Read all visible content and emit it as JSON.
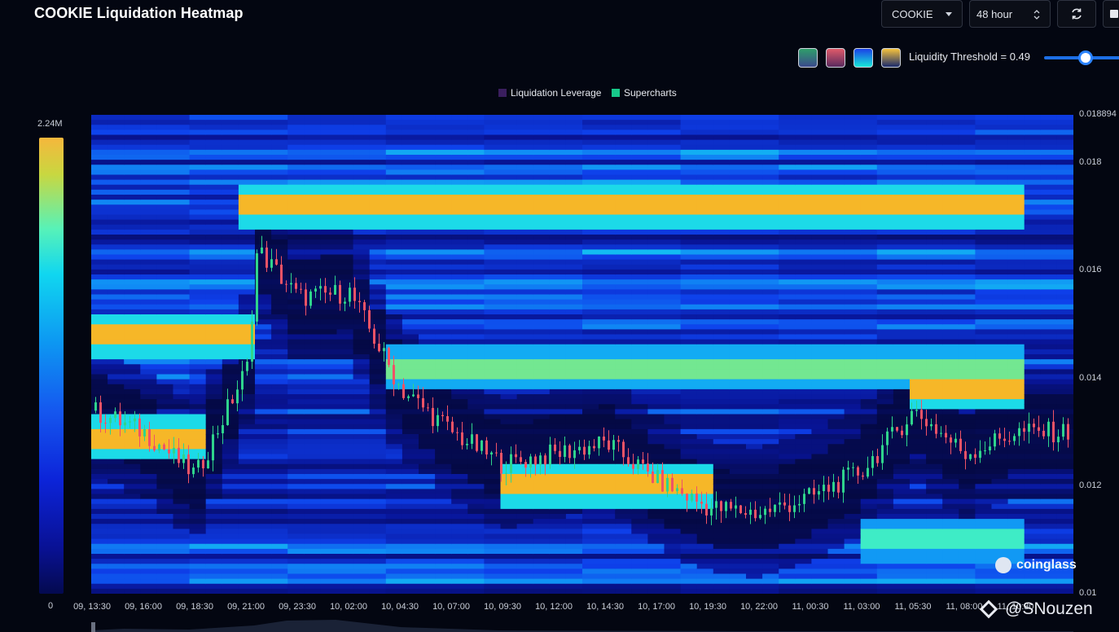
{
  "header": {
    "title": "COOKIE Liquidation Heatmap",
    "symbol_value": "COOKIE",
    "range_value": "48 hour"
  },
  "controls": {
    "threshold_label": "Liquidity Threshold = 0.49",
    "threshold_value": 0.49,
    "palettes": [
      {
        "name": "palette-1",
        "from": "#2e9e6a",
        "to": "#3c4a8c"
      },
      {
        "name": "palette-2",
        "from": "#e05a6a",
        "to": "#5a2a5e"
      },
      {
        "name": "palette-3",
        "from": "#1a40e8",
        "to": "#18e8d8"
      },
      {
        "name": "palette-4",
        "from": "#f6c23c",
        "to": "#1a2a6c"
      }
    ]
  },
  "legend": [
    {
      "label": "Liquidation Leverage",
      "color": "#3a1e5e"
    },
    {
      "label": "Supercharts",
      "color": "#17c98a"
    }
  ],
  "colorbar": {
    "max_label": "2.24M",
    "min_label": "0"
  },
  "brand": "coinglass",
  "credit": "@SNouzen",
  "chart_data": {
    "type": "heatmap",
    "title": "COOKIE Liquidation Heatmap",
    "x_ticks": [
      "09, 13:30",
      "09, 16:00",
      "09, 18:30",
      "09, 21:00",
      "09, 23:30",
      "10, 02:00",
      "10, 04:30",
      "10, 07:00",
      "10, 09:30",
      "10, 12:00",
      "10, 14:30",
      "10, 17:00",
      "10, 19:30",
      "10, 22:00",
      "11, 00:30",
      "11, 03:00",
      "11, 05:30",
      "11, 08:00",
      "11, 10:30"
    ],
    "y_ticks": [
      "0.018894",
      "0.018",
      "0.016",
      "0.014",
      "0.012",
      "0.01"
    ],
    "ylim": [
      0.01,
      0.018894
    ],
    "value_range": [
      0,
      2240000
    ],
    "price_close_path": [
      {
        "t": "09, 13:30",
        "price": 0.0134
      },
      {
        "t": "09, 16:00",
        "price": 0.013
      },
      {
        "t": "09, 18:30",
        "price": 0.0122
      },
      {
        "t": "09, 21:00",
        "price": 0.0142
      },
      {
        "t": "09, 21:30",
        "price": 0.0164
      },
      {
        "t": "09, 23:30",
        "price": 0.0155
      },
      {
        "t": "10, 02:00",
        "price": 0.0156
      },
      {
        "t": "10, 04:30",
        "price": 0.0138
      },
      {
        "t": "10, 07:00",
        "price": 0.013
      },
      {
        "t": "10, 09:30",
        "price": 0.0124
      },
      {
        "t": "10, 12:00",
        "price": 0.0126
      },
      {
        "t": "10, 14:30",
        "price": 0.0128
      },
      {
        "t": "10, 17:00",
        "price": 0.0121
      },
      {
        "t": "10, 19:30",
        "price": 0.0116
      },
      {
        "t": "10, 22:00",
        "price": 0.0115
      },
      {
        "t": "11, 00:30",
        "price": 0.0118
      },
      {
        "t": "11, 03:00",
        "price": 0.0123
      },
      {
        "t": "11, 05:30",
        "price": 0.0134
      },
      {
        "t": "11, 08:00",
        "price": 0.0126
      },
      {
        "t": "11, 10:30",
        "price": 0.013
      }
    ],
    "liquidation_bands": [
      {
        "price": 0.0172,
        "level": 1.0,
        "from": "09, 21:00",
        "to": "11, 10:30"
      },
      {
        "price": 0.0148,
        "level": 1.0,
        "from": "09, 13:30",
        "to": "09, 21:00"
      },
      {
        "price": 0.0142,
        "level": 0.85,
        "from": "10, 04:30",
        "to": "11, 10:30"
      },
      {
        "price": 0.0138,
        "level": 1.0,
        "from": "11, 05:30",
        "to": "11, 10:30"
      },
      {
        "price": 0.0129,
        "level": 1.0,
        "from": "09, 13:30",
        "to": "09, 18:30"
      },
      {
        "price": 0.012,
        "level": 1.0,
        "from": "10, 09:30",
        "to": "10, 19:30"
      },
      {
        "price": 0.011,
        "level": 0.8,
        "from": "11, 03:00",
        "to": "11, 10:30"
      }
    ]
  }
}
